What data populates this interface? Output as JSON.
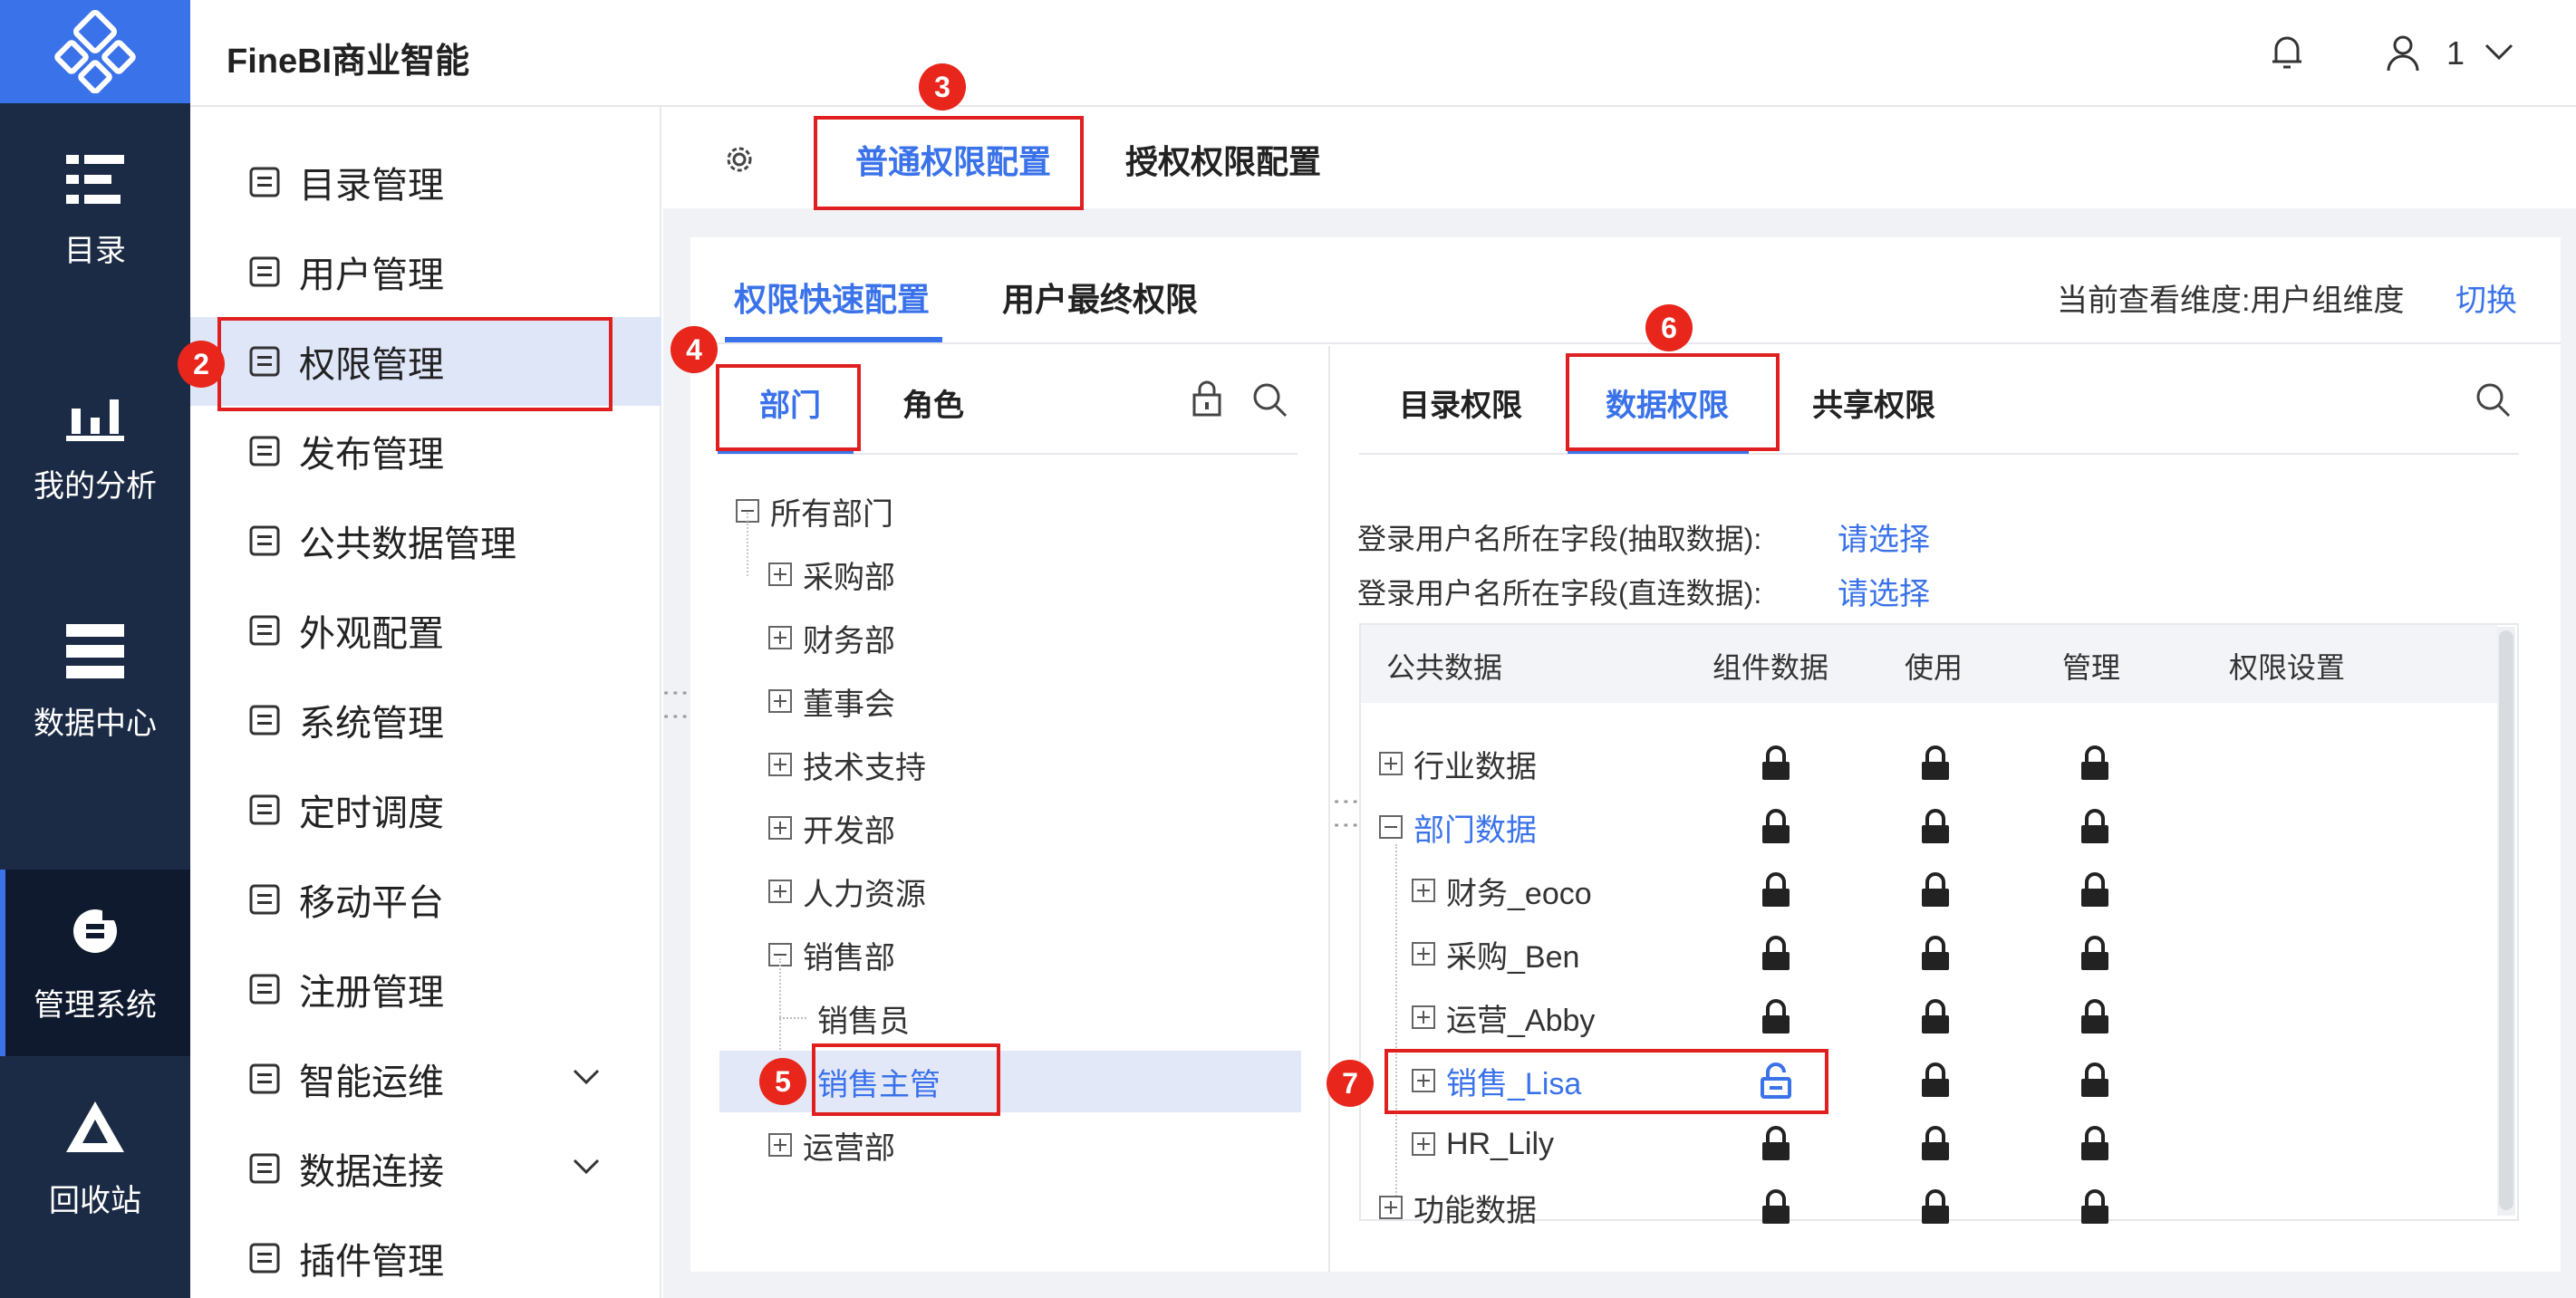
{
  "brand": "FineBI商业智能",
  "header": {
    "user_name": "1"
  },
  "rail": [
    {
      "label": "目录",
      "icon": "catalog-icon"
    },
    {
      "label": "我的分析",
      "icon": "analysis-icon"
    },
    {
      "label": "数据中心",
      "icon": "data-center-icon"
    },
    {
      "label": "管理系统",
      "icon": "management-icon",
      "active": true
    },
    {
      "label": "回收站",
      "icon": "recycle-icon"
    }
  ],
  "menu": [
    {
      "label": "目录管理",
      "icon": "list-icon"
    },
    {
      "label": "用户管理",
      "icon": "user-icon"
    },
    {
      "label": "权限管理",
      "icon": "permission-icon",
      "active": true
    },
    {
      "label": "发布管理",
      "icon": "publish-icon"
    },
    {
      "label": "公共数据管理",
      "icon": "public-data-icon"
    },
    {
      "label": "外观配置",
      "icon": "appearance-icon"
    },
    {
      "label": "系统管理",
      "icon": "settings-icon"
    },
    {
      "label": "定时调度",
      "icon": "timer-icon"
    },
    {
      "label": "移动平台",
      "icon": "mobile-icon"
    },
    {
      "label": "注册管理",
      "icon": "register-icon"
    },
    {
      "label": "智能运维",
      "icon": "ops-icon",
      "expandable": true
    },
    {
      "label": "数据连接",
      "icon": "link-icon",
      "expandable": true
    },
    {
      "label": "插件管理",
      "icon": "plugin-icon"
    }
  ],
  "top_tabs": {
    "normal": "普通权限配置",
    "grant": "授权权限配置"
  },
  "sub_tabs": {
    "quick": "权限快速配置",
    "final": "用户最终权限"
  },
  "view_dimension": "当前查看维度:用户组维度",
  "switch_label": "切换",
  "left_tabs": {
    "dept": "部门",
    "role": "角色"
  },
  "tree": {
    "root": "所有部门",
    "depts": [
      "采购部",
      "财务部",
      "董事会",
      "技术支持",
      "开发部",
      "人力资源"
    ],
    "sales": "销售部",
    "sales_children": [
      "销售员",
      "销售主管"
    ],
    "ops": "运营部"
  },
  "right_tabs": {
    "catalog": "目录权限",
    "data": "数据权限",
    "share": "共享权限"
  },
  "fields": {
    "extract_label": "登录用户名所在字段(抽取数据):",
    "direct_label": "登录用户名所在字段(直连数据):",
    "select_label": "请选择"
  },
  "table": {
    "headers": [
      "公共数据",
      "组件数据",
      "使用",
      "管理",
      "权限设置"
    ],
    "rows": [
      {
        "name": "行业数据",
        "level": 0,
        "expanded": false,
        "unlocked": false
      },
      {
        "name": "部门数据",
        "level": 0,
        "expanded": true,
        "blue": true,
        "unlocked": false
      },
      {
        "name": "财务_eoco",
        "level": 1,
        "expanded": false,
        "unlocked": false
      },
      {
        "name": "采购_Ben",
        "level": 1,
        "expanded": false,
        "unlocked": false
      },
      {
        "name": "运营_Abby",
        "level": 1,
        "expanded": false,
        "unlocked": false
      },
      {
        "name": "销售_Lisa",
        "level": 1,
        "expanded": false,
        "blue": true,
        "unlocked": true
      },
      {
        "name": "HR_Lily",
        "level": 1,
        "expanded": false,
        "unlocked": false
      },
      {
        "name": "功能数据",
        "level": 0,
        "expanded": false,
        "unlocked": false
      }
    ]
  },
  "badges": [
    "2",
    "3",
    "4",
    "5",
    "6",
    "7"
  ],
  "colors": {
    "accent": "#3a72ea",
    "rail": "#1c2b45",
    "annotation": "#e02020"
  }
}
